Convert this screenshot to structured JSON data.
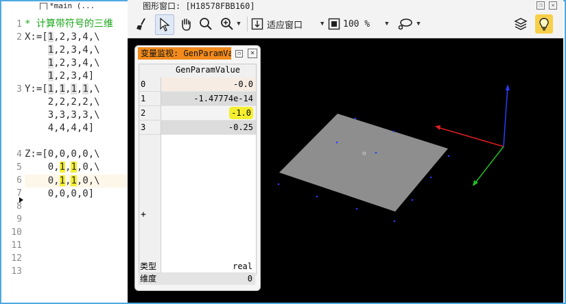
{
  "editor": {
    "tab_title": "*main (...",
    "comment_line": "* 计算带符号的三维",
    "line_numbers": [
      "1",
      "2",
      "3",
      "4",
      "5",
      "6",
      "7",
      "8",
      "9",
      "10",
      "11",
      "12",
      "13"
    ]
  },
  "graphics_window": {
    "title": "图形窗口: [H18578FBB160]",
    "fit_window_label": "适应窗口",
    "zoom_label": "100 %"
  },
  "variable_monitor": {
    "title": "变量监视: GenParamValue",
    "column_header": "GenParamValue",
    "rows": [
      {
        "index": "0",
        "value": "-0.0"
      },
      {
        "index": "1",
        "value": "-1.47774e-14"
      },
      {
        "index": "2",
        "value": "-1.0"
      },
      {
        "index": "3",
        "value": "-0.25"
      }
    ],
    "plus_label": "+",
    "type_label": "类型",
    "type_value": "real",
    "dim_label": "维度",
    "dim_value": "0"
  },
  "colors": {
    "accent_orange": "#f28b1c",
    "highlight_yellow": "#f4ef2e",
    "axis_red": "#e02020",
    "axis_green": "#1fbf1f",
    "axis_blue": "#2a3cff",
    "plane_gray": "#8e8e8e"
  }
}
